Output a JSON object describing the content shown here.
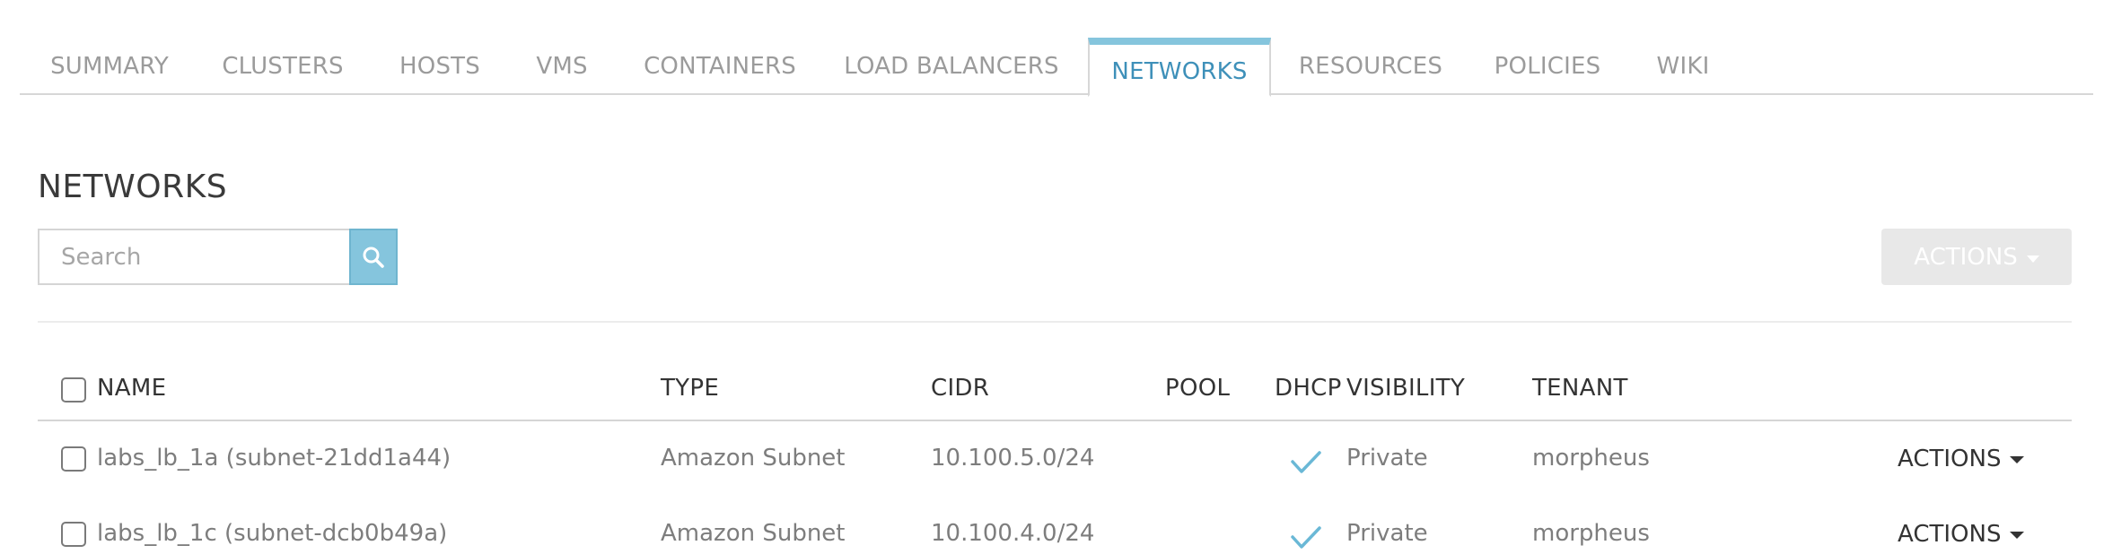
{
  "tabs": [
    {
      "label": "SUMMARY",
      "active": false
    },
    {
      "label": "CLUSTERS",
      "active": false
    },
    {
      "label": "HOSTS",
      "active": false
    },
    {
      "label": "VMS",
      "active": false
    },
    {
      "label": "CONTAINERS",
      "active": false
    },
    {
      "label": "LOAD BALANCERS",
      "active": false
    },
    {
      "label": "NETWORKS",
      "active": true
    },
    {
      "label": "RESOURCES",
      "active": false
    },
    {
      "label": "POLICIES",
      "active": false
    },
    {
      "label": "WIKI",
      "active": false
    }
  ],
  "page": {
    "title": "NETWORKS",
    "search_placeholder": "Search",
    "search_value": "",
    "actions_label": "ACTIONS"
  },
  "table": {
    "headers": {
      "name": "NAME",
      "type": "TYPE",
      "cidr": "CIDR",
      "pool": "POOL",
      "dhcp": "DHCP",
      "visibility": "VISIBILITY",
      "tenant": "TENANT"
    },
    "rows": [
      {
        "name": "labs_lb_1a (subnet-21dd1a44)",
        "type": "Amazon Subnet",
        "cidr": "10.100.5.0/24",
        "pool": "",
        "dhcp": true,
        "visibility": "Private",
        "tenant": "morpheus",
        "actions": "ACTIONS"
      },
      {
        "name": "labs_lb_1c (subnet-dcb0b49a)",
        "type": "Amazon Subnet",
        "cidr": "10.100.4.0/24",
        "pool": "",
        "dhcp": true,
        "visibility": "Private",
        "tenant": "morpheus",
        "actions": "ACTIONS"
      }
    ]
  },
  "colors": {
    "accent": "#85c5dd",
    "active_tab_text": "#3e90b9",
    "check": "#6ab8d6"
  },
  "icons": {
    "search": "search-icon",
    "dhcp": "checkmark-icon",
    "dropdown": "caret-down-icon"
  }
}
